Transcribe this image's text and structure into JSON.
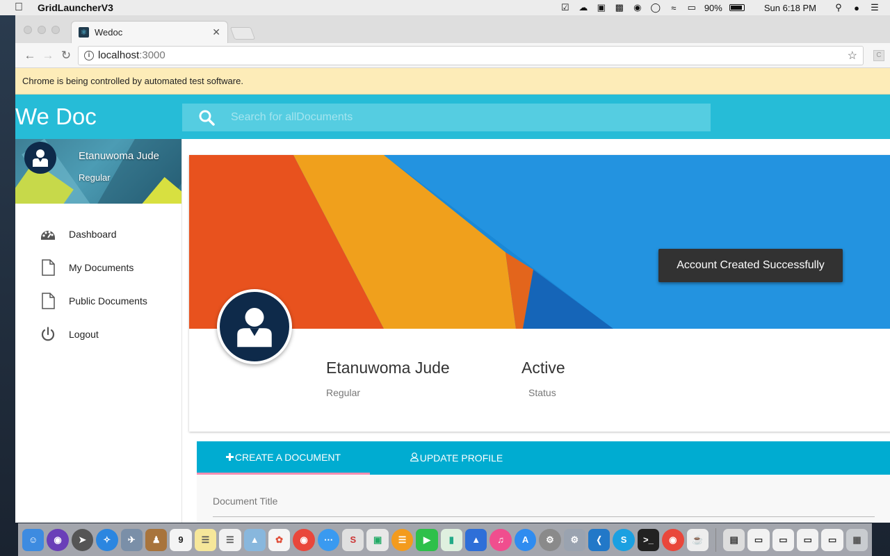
{
  "menubar": {
    "app_name": "GridLauncherV3",
    "battery": "90%",
    "clock": "Sun 6:18 PM"
  },
  "browser": {
    "tab_title": "Wedoc",
    "url_host": "localhost",
    "url_port": ":3000",
    "infobar": "Chrome is being controlled by automated test software."
  },
  "app": {
    "brand": "We Doc",
    "search_placeholder": "Search for allDocuments",
    "user": {
      "name": "Etanuwoma Jude",
      "role": "Regular"
    },
    "nav": [
      {
        "label": "Dashboard",
        "icon": "palette-icon"
      },
      {
        "label": "My Documents",
        "icon": "document-icon"
      },
      {
        "label": "Public Documents",
        "icon": "document-icon"
      },
      {
        "label": "Logout",
        "icon": "power-icon"
      }
    ],
    "profile": {
      "name": "Etanuwoma Jude",
      "role": "Regular",
      "status": "Active",
      "status_label": "Status"
    },
    "tabs": [
      {
        "label": "CREATE A DOCUMENT",
        "icon": "plus-icon",
        "active": true
      },
      {
        "label": "UPDATE PROFILE",
        "icon": "user-outline-icon",
        "active": false
      }
    ],
    "form": {
      "document_title_label": "Document Title"
    },
    "toast": "Account Created Successfully"
  },
  "colors": {
    "primary": "#26bcd7",
    "tabs": "#00acd1",
    "avatar": "#0e2a4a",
    "toast": "#323232",
    "infobar": "#fdecb8",
    "tab_indicator": "#f48fb1"
  }
}
